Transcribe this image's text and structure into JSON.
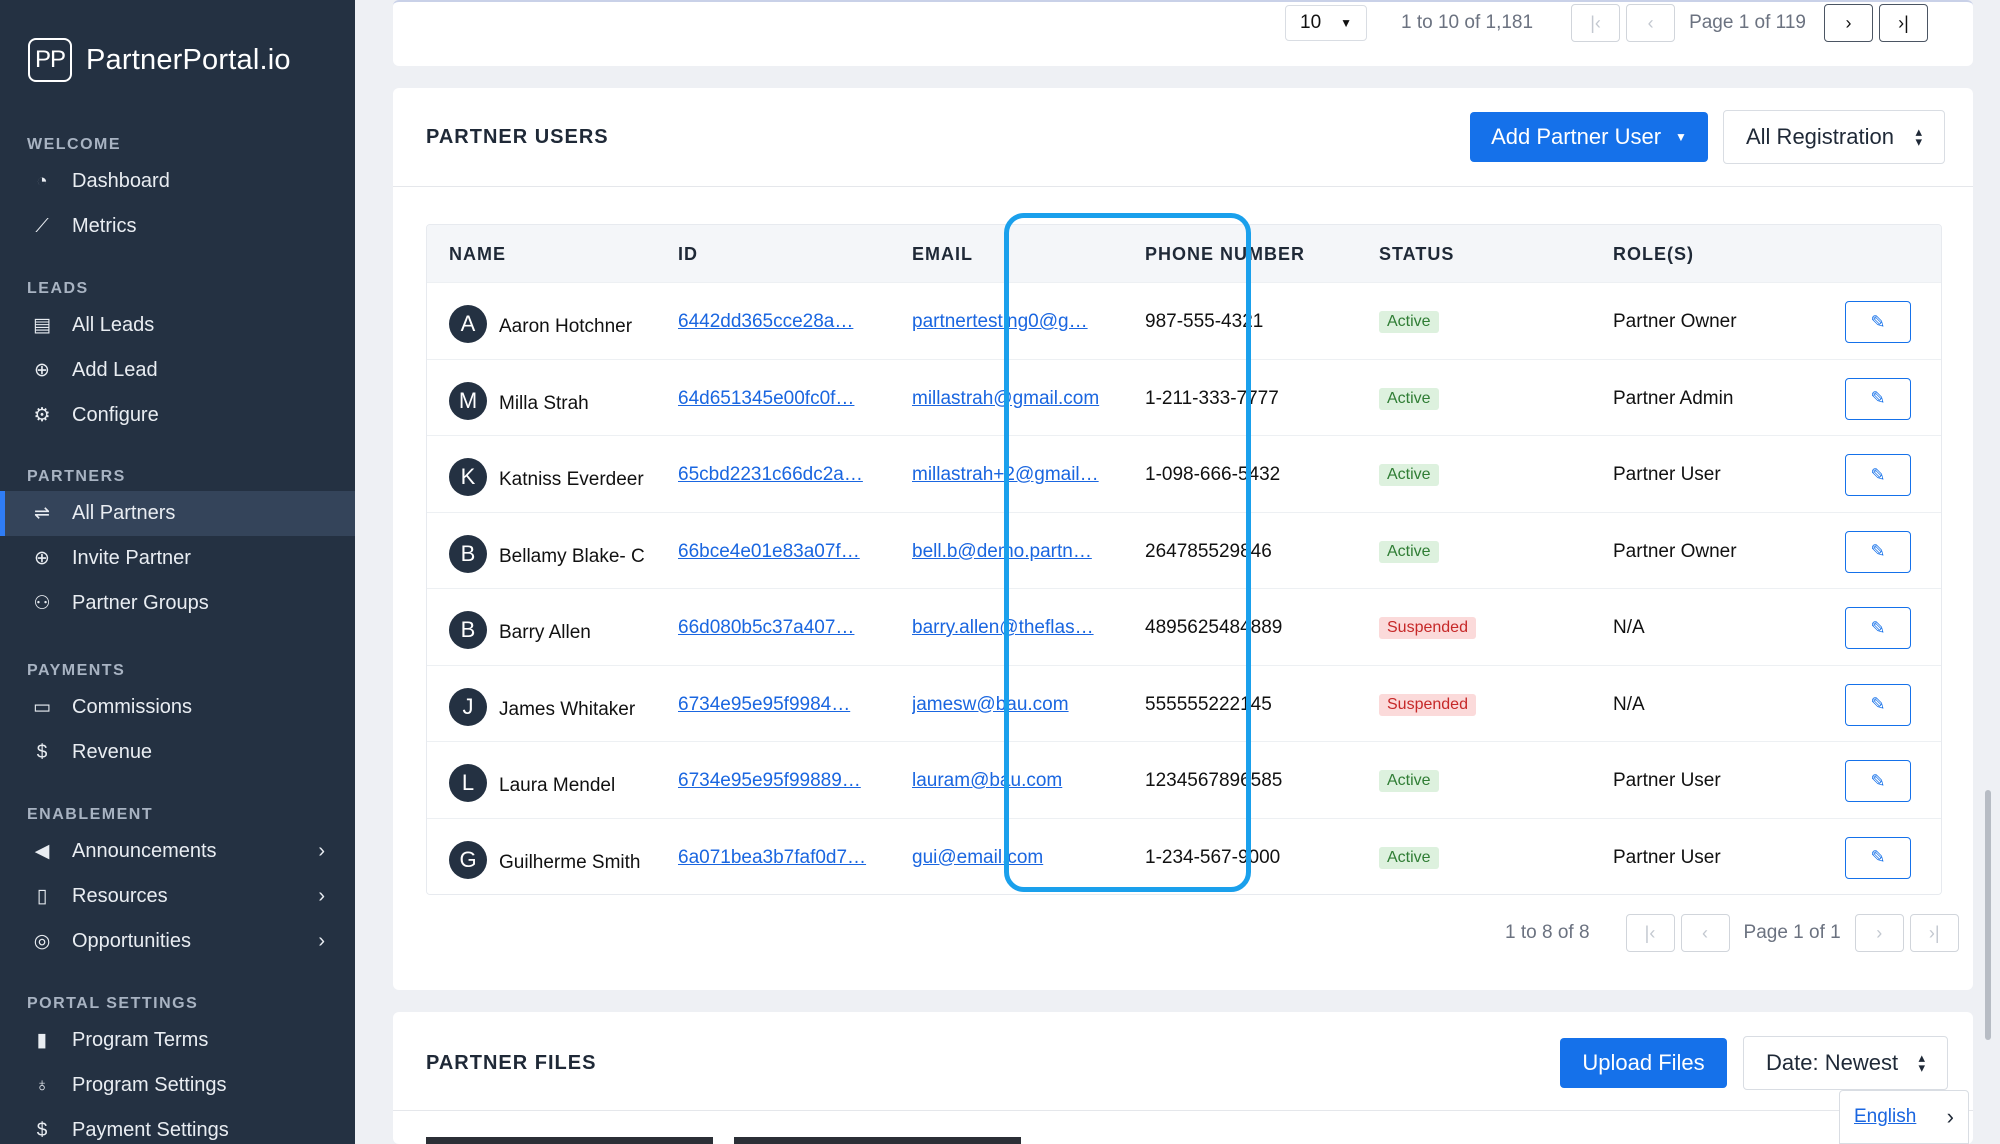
{
  "brand": {
    "mark": "PP",
    "name": "PartnerPortal.io"
  },
  "sidebar": {
    "sections": [
      {
        "label": "WELCOME",
        "items": [
          {
            "label": "Dashboard",
            "icon": "dashboard-icon"
          },
          {
            "label": "Metrics",
            "icon": "chart-line-icon"
          }
        ]
      },
      {
        "label": "LEADS",
        "items": [
          {
            "label": "All Leads",
            "icon": "clipboard-icon"
          },
          {
            "label": "Add Lead",
            "icon": "plus-circle-icon"
          },
          {
            "label": "Configure",
            "icon": "gear-icon"
          }
        ]
      },
      {
        "label": "PARTNERS",
        "items": [
          {
            "label": "All Partners",
            "icon": "handshake-icon",
            "active": true
          },
          {
            "label": "Invite Partner",
            "icon": "plus-circle-icon"
          },
          {
            "label": "Partner Groups",
            "icon": "users-icon"
          }
        ]
      },
      {
        "label": "PAYMENTS",
        "items": [
          {
            "label": "Commissions",
            "icon": "credit-card-icon"
          },
          {
            "label": "Revenue",
            "icon": "dollar-icon"
          }
        ]
      },
      {
        "label": "ENABLEMENT",
        "items": [
          {
            "label": "Announcements",
            "icon": "megaphone-icon",
            "chevron": true
          },
          {
            "label": "Resources",
            "icon": "book-icon",
            "chevron": true
          },
          {
            "label": "Opportunities",
            "icon": "target-icon",
            "chevron": true
          }
        ]
      },
      {
        "label": "PORTAL SETTINGS",
        "items": [
          {
            "label": "Program Terms",
            "icon": "document-icon"
          },
          {
            "label": "Program Settings",
            "icon": "award-icon"
          },
          {
            "label": "Payment Settings",
            "icon": "dollar-icon"
          }
        ]
      }
    ]
  },
  "top_pager": {
    "page_size": "10",
    "range": "1 to 10 of 1,181",
    "page": "Page 1 of 119"
  },
  "partner_users": {
    "title": "PARTNER USERS",
    "add_button": "Add Partner User",
    "filter": "All Registration",
    "columns": {
      "name": "NAME",
      "id": "ID",
      "email": "EMAIL",
      "phone": "PHONE NUMBER",
      "status": "STATUS",
      "roles": "ROLE(S)"
    },
    "rows": [
      {
        "initial": "A",
        "name": "Aaron Hotchner",
        "id": "6442dd365cce28a…",
        "email": "partnertesting0@g…",
        "phone": "987-555-4321",
        "status": "Active",
        "role": "Partner Owner"
      },
      {
        "initial": "M",
        "name": "Milla Strah",
        "id": "64d651345e00fc0f…",
        "email": "millastrah@gmail.com",
        "phone": "1-211-333-7777",
        "status": "Active",
        "role": "Partner Admin"
      },
      {
        "initial": "K",
        "name": "Katniss Everdeer",
        "id": "65cbd2231c66dc2a…",
        "email": "millastrah+2@gmail…",
        "phone": "1-098-666-5432",
        "status": "Active",
        "role": "Partner User"
      },
      {
        "initial": "B",
        "name": "Bellamy Blake- C",
        "id": "66bce4e01e83a07f…",
        "email": "bell.b@demo.partn…",
        "phone": "264785529846",
        "status": "Active",
        "role": "Partner Owner"
      },
      {
        "initial": "B",
        "name": "Barry Allen",
        "id": "66d080b5c37a407…",
        "email": "barry.allen@theflas…",
        "phone": "4895625484889",
        "status": "Suspended",
        "role": "N/A"
      },
      {
        "initial": "J",
        "name": "James Whitaker",
        "id": "6734e95e95f9984…",
        "email": "jamesw@bau.com",
        "phone": "555555222145",
        "status": "Suspended",
        "role": "N/A"
      },
      {
        "initial": "L",
        "name": "Laura Mendel",
        "id": "6734e95e95f99889…",
        "email": "lauram@bau.com",
        "phone": "1234567896585",
        "status": "Active",
        "role": "Partner User"
      },
      {
        "initial": "G",
        "name": "Guilherme Smith",
        "id": "6a071bea3b7faf0d7…",
        "email": "gui@email.com",
        "phone": "1-234-567-9000",
        "status": "Active",
        "role": "Partner User"
      }
    ],
    "pager": {
      "range": "1 to 8 of 8",
      "page": "Page 1 of 1"
    }
  },
  "partner_files": {
    "title": "PARTNER FILES",
    "upload_button": "Upload Files",
    "sort": "Date: Newest"
  },
  "language": {
    "label": "English"
  },
  "colors": {
    "sidebar": "#243142",
    "primary": "#1571ea",
    "highlight": "#1aa0ec"
  }
}
